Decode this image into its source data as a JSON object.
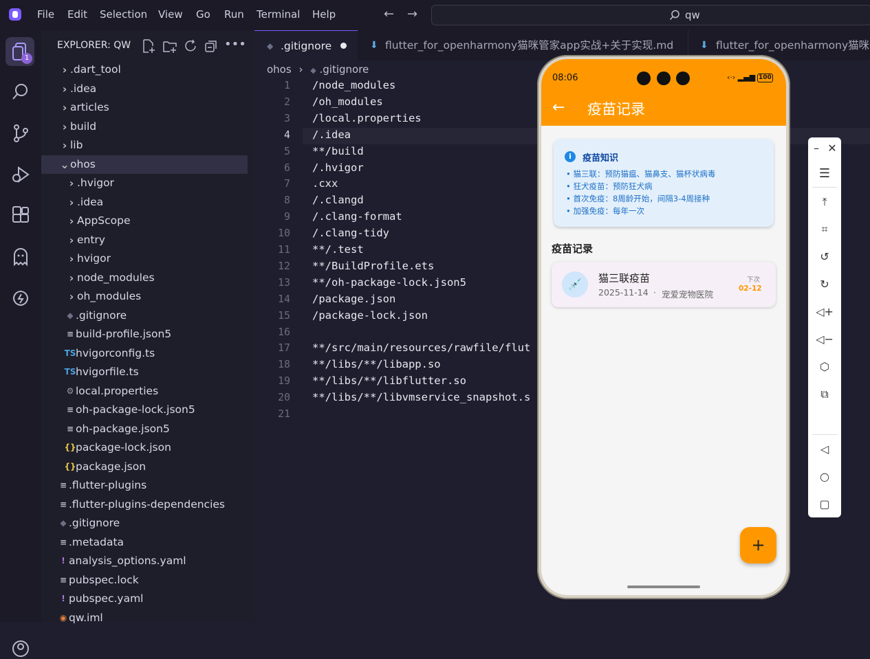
{
  "menu": [
    "File",
    "Edit",
    "Selection",
    "View",
    "Go",
    "Run",
    "Terminal",
    "Help"
  ],
  "search": {
    "text": "qw"
  },
  "activity_badge": "1",
  "explorer": {
    "title": "EXPLORER: QW",
    "items": [
      {
        "label": ".dart_tool",
        "type": "folder",
        "depth": 0
      },
      {
        "label": ".idea",
        "type": "folder",
        "depth": 0
      },
      {
        "label": "articles",
        "type": "folder",
        "depth": 0
      },
      {
        "label": "build",
        "type": "folder",
        "depth": 0
      },
      {
        "label": "lib",
        "type": "folder",
        "depth": 0
      },
      {
        "label": "ohos",
        "type": "folder-open",
        "depth": 0
      },
      {
        "label": ".hvigor",
        "type": "folder",
        "depth": 1
      },
      {
        "label": ".idea",
        "type": "folder",
        "depth": 1
      },
      {
        "label": "AppScope",
        "type": "folder",
        "depth": 1
      },
      {
        "label": "entry",
        "type": "folder",
        "depth": 1
      },
      {
        "label": "hvigor",
        "type": "folder",
        "depth": 1
      },
      {
        "label": "node_modules",
        "type": "folder",
        "depth": 1
      },
      {
        "label": "oh_modules",
        "type": "folder",
        "depth": 1
      },
      {
        "label": ".gitignore",
        "type": "git",
        "depth": 1
      },
      {
        "label": "build-profile.json5",
        "type": "lines",
        "depth": 1
      },
      {
        "label": "hvigorconfig.ts",
        "type": "ts",
        "depth": 1
      },
      {
        "label": "hvigorfile.ts",
        "type": "ts",
        "depth": 1
      },
      {
        "label": "local.properties",
        "type": "gear",
        "depth": 1
      },
      {
        "label": "oh-package-lock.json5",
        "type": "lines",
        "depth": 1
      },
      {
        "label": "oh-package.json5",
        "type": "lines",
        "depth": 1
      },
      {
        "label": "package-lock.json",
        "type": "json",
        "depth": 1
      },
      {
        "label": "package.json",
        "type": "json",
        "depth": 1
      },
      {
        "label": ".flutter-plugins",
        "type": "lines",
        "depth": 0
      },
      {
        "label": ".flutter-plugins-dependencies",
        "type": "lines",
        "depth": 0
      },
      {
        "label": ".gitignore",
        "type": "git",
        "depth": 0
      },
      {
        "label": ".metadata",
        "type": "lines",
        "depth": 0
      },
      {
        "label": "analysis_options.yaml",
        "type": "yaml",
        "depth": 0
      },
      {
        "label": "pubspec.lock",
        "type": "lines",
        "depth": 0
      },
      {
        "label": "pubspec.yaml",
        "type": "yaml",
        "depth": 0
      },
      {
        "label": "qw.iml",
        "type": "rss",
        "depth": 0
      }
    ]
  },
  "tabs": [
    {
      "label": ".gitignore",
      "active": true
    },
    {
      "label": "flutter_for_openharmony猫咪管家app实战+关于实现.md",
      "active": false
    },
    {
      "label": "flutter_for_openharmony猫咪管",
      "active": false
    }
  ],
  "breadcrumb": {
    "folder": "ohos",
    "file": ".gitignore"
  },
  "code_lines": [
    "/node_modules",
    "/oh_modules",
    "/local.properties",
    "/.idea",
    "**/build",
    "/.hvigor",
    ".cxx",
    "/.clangd",
    "/.clang-format",
    "/.clang-tidy",
    "**/.test",
    "**/BuildProfile.ets",
    "**/oh-package-lock.json5",
    "/package.json",
    "/package-lock.json",
    "",
    "**/src/main/resources/rawfile/flut",
    "**/libs/**/libapp.so",
    "**/libs/**/libflutter.so",
    "**/libs/**/libvmservice_snapshot.s",
    ""
  ],
  "current_line": 4,
  "phone": {
    "time": "08:06",
    "battery": "100",
    "appbar_title": "疫苗记录",
    "info_card": {
      "title": "疫苗知识",
      "lines": [
        "• 猫三联：预防猫瘟、猫鼻支、猫杯状病毒",
        "• 狂犬疫苗：预防狂犬病",
        "• 首次免疫：8周龄开始，间隔3-4周接种",
        "• 加强免疫：每年一次"
      ]
    },
    "section_title": "疫苗记录",
    "records": [
      {
        "name": "猫三联疫苗",
        "date": "2025-11-14",
        "hospital": "宠爱宠物医院",
        "next_label": "下次",
        "next_date": "02-12"
      }
    ],
    "fab": "+"
  },
  "colors": {
    "accent": "#ff9800",
    "info_bg": "#e3f0fb",
    "info_text": "#1565c0",
    "next_date": "#ff9800"
  }
}
